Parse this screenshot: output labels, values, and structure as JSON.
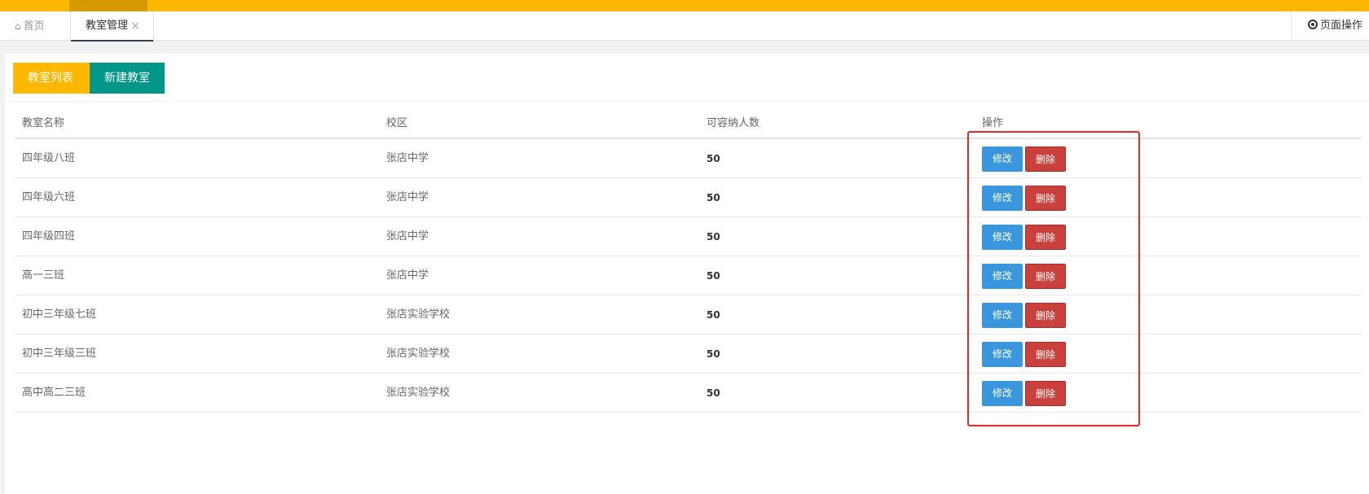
{
  "tabs": {
    "home_label": "首页",
    "classroom_label": "教室管理",
    "close_glyph": "×",
    "page_ops_label": "页面操作"
  },
  "actions": {
    "list_label": "教室列表",
    "new_label": "新建教室"
  },
  "table": {
    "headers": [
      "教室名称",
      "校区",
      "可容纳人数",
      "操作"
    ],
    "rows": [
      {
        "name": "四年级八班",
        "campus": "张店中学",
        "capacity": "50"
      },
      {
        "name": "四年级六班",
        "campus": "张店中学",
        "capacity": "50"
      },
      {
        "name": "四年级四班",
        "campus": "张店中学",
        "capacity": "50"
      },
      {
        "name": "高一三班",
        "campus": "张店中学",
        "capacity": "50"
      },
      {
        "name": "初中三年级七班",
        "campus": "张店实验学校",
        "capacity": "50"
      },
      {
        "name": "初中三年级三班",
        "campus": "张店实验学校",
        "capacity": "50"
      },
      {
        "name": "高中高二三班",
        "campus": "张店实验学校",
        "capacity": "50"
      }
    ],
    "edit_label": "修改",
    "delete_label": "删除"
  },
  "colors": {
    "topbar": "#ffb800",
    "btn_list": "#ffb800",
    "btn_new": "#009688",
    "btn_edit": "#3a97dd",
    "btn_delete": "#c9403c",
    "highlight": "#e3272b"
  }
}
